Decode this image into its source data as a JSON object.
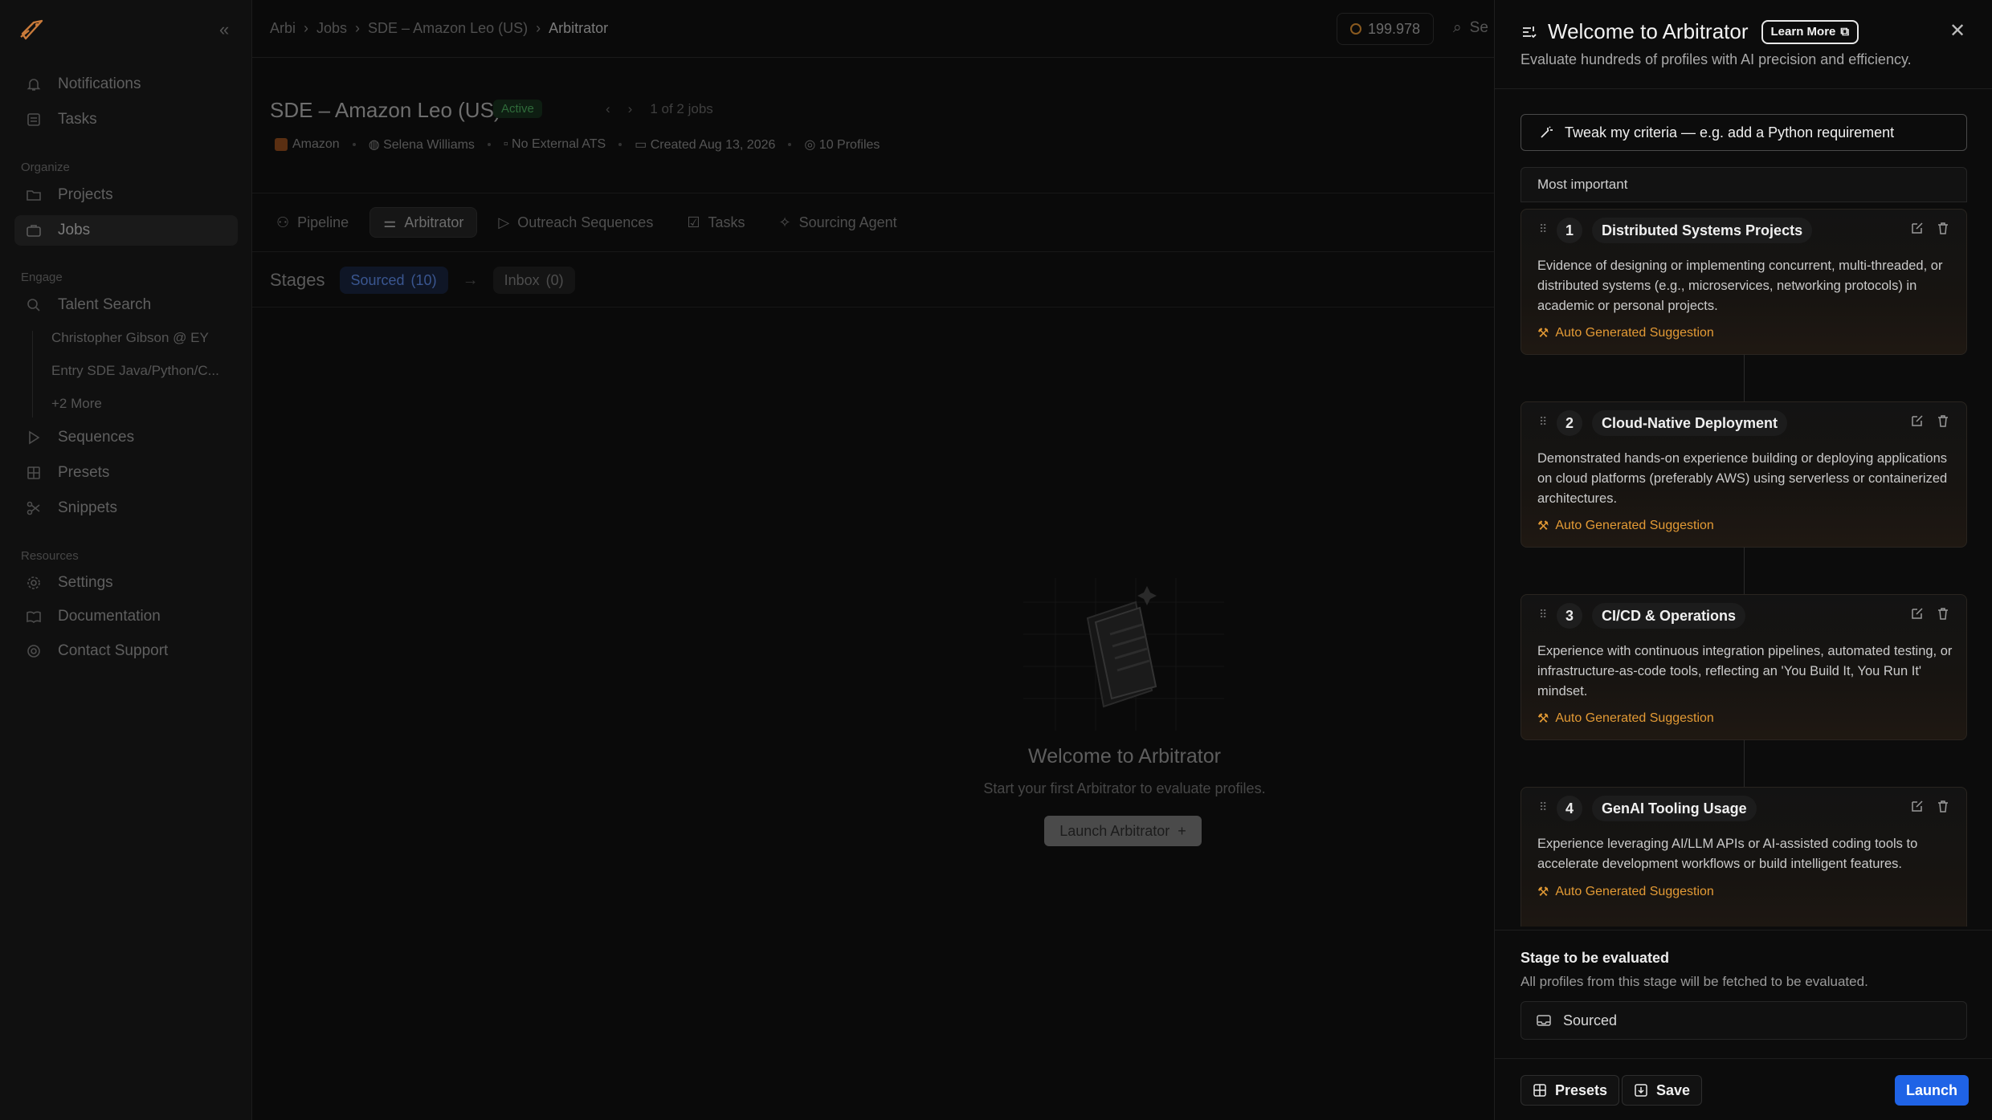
{
  "sidebar": {
    "items_top": [
      {
        "label": "Notifications",
        "icon": "bell-icon"
      },
      {
        "label": "Tasks",
        "icon": "checklist-icon"
      }
    ],
    "organize_label": "Organize",
    "organize": [
      {
        "label": "Projects",
        "icon": "folder-icon"
      },
      {
        "label": "Jobs",
        "icon": "briefcase-icon"
      }
    ],
    "engage_label": "Engage",
    "talent_search": {
      "label": "Talent Search",
      "icon": "search-icon"
    },
    "talent_sub": [
      "Christopher Gibson @ EY",
      "Entry SDE Java/Python/C...",
      "+2 More"
    ],
    "engage": [
      {
        "label": "Sequences",
        "icon": "play-icon"
      },
      {
        "label": "Presets",
        "icon": "grid-icon"
      },
      {
        "label": "Snippets",
        "icon": "scissors-icon"
      }
    ],
    "resources_label": "Resources",
    "resources": [
      {
        "label": "Settings",
        "icon": "gear-icon"
      },
      {
        "label": "Documentation",
        "icon": "book-icon"
      },
      {
        "label": "Contact Support",
        "icon": "support-icon"
      }
    ]
  },
  "topbar": {
    "breadcrumbs": [
      "Arbi",
      "Jobs",
      "SDE – Amazon Leo (US)",
      "Arbitrator"
    ],
    "credits": "199.978",
    "search_stub": "Se"
  },
  "job": {
    "title": "SDE – Amazon Leo (US)",
    "status": "Active",
    "pager": "1 of 2 jobs",
    "company": "Amazon",
    "owner": "Selena Williams",
    "ats": "No External ATS",
    "created": "Created Aug 13, 2026",
    "profiles": "10 Profiles"
  },
  "tabs": [
    {
      "label": "Pipeline",
      "icon": "people-icon"
    },
    {
      "label": "Arbitrator",
      "icon": "sliders-icon"
    },
    {
      "label": "Outreach Sequences",
      "icon": "send-icon"
    },
    {
      "label": "Tasks",
      "icon": "checkbox-icon"
    },
    {
      "label": "Sourcing Agent",
      "icon": "agent-icon"
    }
  ],
  "stages": {
    "label": "Stages",
    "sourced": "Sourced",
    "sourced_count": "(10)",
    "inbox": "Inbox",
    "inbox_count": "(0)"
  },
  "empty": {
    "title": "Welcome to Arbitrator",
    "subtitle": "Start your first Arbitrator to evaluate profiles.",
    "button": "Launch Arbitrator"
  },
  "panel": {
    "title": "Welcome to Arbitrator",
    "learn_more": "Learn More",
    "subtitle": "Evaluate hundreds of profiles with AI precision and efficiency.",
    "tweak_placeholder": "Tweak my criteria — e.g. add a Python requirement",
    "criteria_header": "Most important",
    "auto_label": "Auto Generated Suggestion",
    "criteria": [
      {
        "num": "1",
        "name": "Distributed Systems Projects",
        "desc": "Evidence of designing or implementing concurrent, multi-threaded, or distributed systems (e.g., microservices, networking protocols) in academic or personal projects."
      },
      {
        "num": "2",
        "name": "Cloud-Native Deployment",
        "desc": "Demonstrated hands-on experience building or deploying applications on cloud platforms (preferably AWS) using serverless or containerized architectures."
      },
      {
        "num": "3",
        "name": "CI/CD & Operations",
        "desc": "Experience with continuous integration pipelines, automated testing, or infrastructure-as-code tools, reflecting an 'You Build It, You Run It' mindset."
      },
      {
        "num": "4",
        "name": "GenAI Tooling Usage",
        "desc": "Experience leveraging AI/LLM APIs or AI-assisted coding tools to accelerate development workflows or build intelligent features."
      }
    ],
    "stage_title": "Stage to be evaluated",
    "stage_sub": "All profiles from this stage will be fetched to be evaluated.",
    "stage_value": "Sourced",
    "presets": "Presets",
    "save": "Save",
    "launch": "Launch"
  }
}
